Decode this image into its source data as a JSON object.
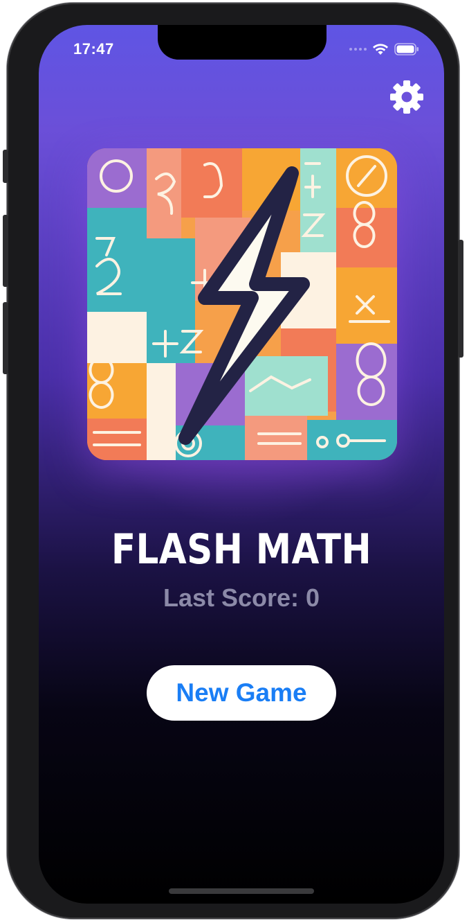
{
  "status_bar": {
    "time": "17:47"
  },
  "app": {
    "title": "FLASH MATH",
    "last_score_label": "Last Score: 0",
    "new_game_label": "New Game"
  },
  "icons": {
    "settings": "gear-icon",
    "wifi": "wifi-icon",
    "battery": "battery-icon",
    "artwork": "lightning-bolt-math-artwork"
  },
  "colors": {
    "button_text": "#1a7ef5",
    "title": "#ffffff",
    "subtitle": "#8c8aa8",
    "gradient_top": "#5f55e4",
    "gradient_bottom": "#000000"
  }
}
